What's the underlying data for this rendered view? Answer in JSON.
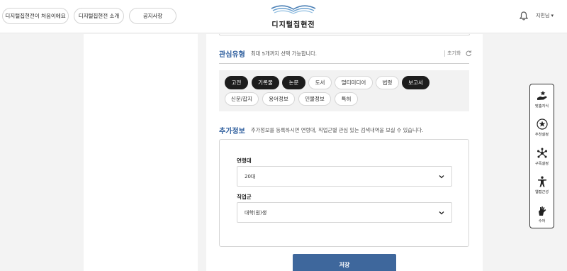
{
  "header": {
    "nav": [
      {
        "label": "디지털집현전이 처음이에요"
      },
      {
        "label": "디지털집현전 소개"
      },
      {
        "label": "공지사항"
      }
    ],
    "logo_text": "디지털집현전",
    "user_label": "지민님 ▾",
    "icons": {
      "bell": "bell-icon"
    }
  },
  "interest": {
    "title": "관심유형",
    "desc": "최대 5개까지 선택 가능합니다.",
    "reset_label": "초기화",
    "chips": [
      {
        "label": "고전",
        "selected": true
      },
      {
        "label": "기록물",
        "selected": true
      },
      {
        "label": "논문",
        "selected": true
      },
      {
        "label": "도서",
        "selected": false
      },
      {
        "label": "멀티미디어",
        "selected": false
      },
      {
        "label": "법령",
        "selected": false
      },
      {
        "label": "보고서",
        "selected": true
      },
      {
        "label": "신문/잡지",
        "selected": false
      },
      {
        "label": "용어정보",
        "selected": false
      },
      {
        "label": "인물정보",
        "selected": false
      },
      {
        "label": "특허",
        "selected": false
      }
    ]
  },
  "extra": {
    "title": "추가정보",
    "desc": "추가정보를 등록하시면 연령대, 직업군별 관심 있는 검색내역을 보실 수 있습니다.",
    "age_label": "연령대",
    "age_value": "20대",
    "job_label": "직업군",
    "job_value": "대학(원)생"
  },
  "save_label": "저장",
  "quick_menu": [
    {
      "label": "맞춤지식",
      "icon": "hand-star-icon"
    },
    {
      "label": "추천설정",
      "icon": "star-circle-icon"
    },
    {
      "label": "구독설정",
      "icon": "network-icon"
    },
    {
      "label": "웹접근성",
      "icon": "accessibility-icon"
    },
    {
      "label": "수어",
      "icon": "sign-language-icon"
    }
  ],
  "colors": {
    "accent": "#2f5f9e",
    "save": "#3e679c",
    "chip_selected": "#1d1d1d"
  }
}
